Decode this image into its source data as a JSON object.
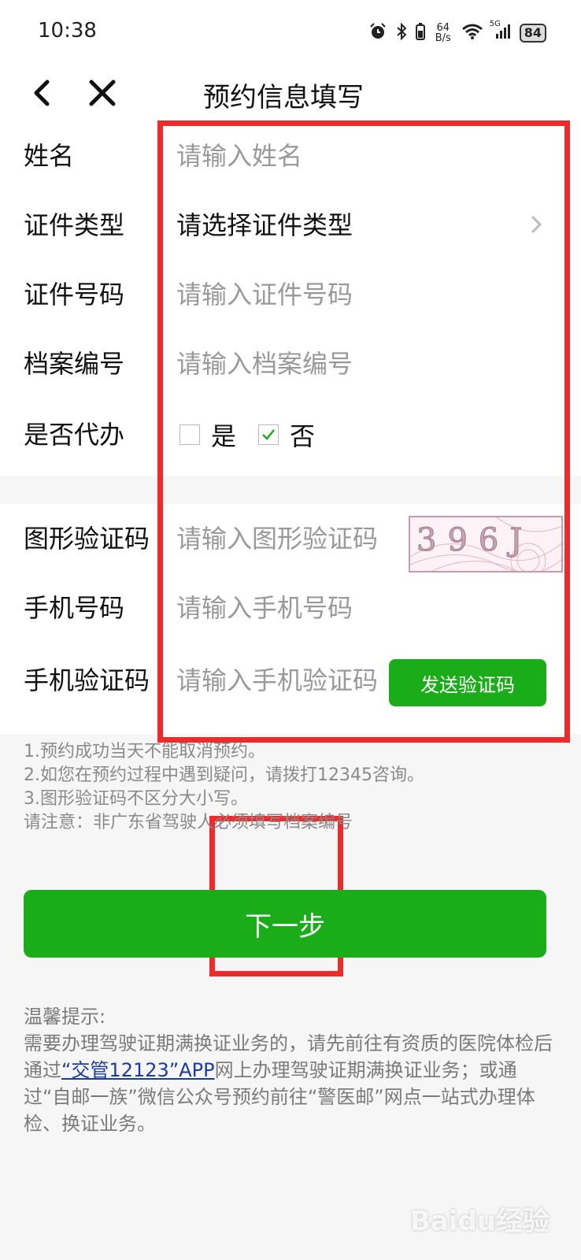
{
  "status_bar": {
    "time": "10:38",
    "net_speed_value": "64",
    "net_speed_unit": "B/s",
    "network": "5G",
    "battery": "84",
    "icons": [
      "alarm-icon",
      "bluetooth-icon",
      "wifi-icon",
      "signal-icon",
      "battery-icon"
    ]
  },
  "nav": {
    "title": "预约信息填写",
    "icons": [
      "back-icon",
      "close-icon"
    ]
  },
  "form": {
    "name_label": "姓名",
    "name_placeholder": "请输入姓名",
    "id_type_label": "证件类型",
    "id_type_value": "请选择证件类型",
    "id_number_label": "证件号码",
    "id_number_placeholder": "请输入证件号码",
    "file_number_label": "档案编号",
    "file_number_placeholder": "请输入档案编号",
    "proxy_label": "是否代办",
    "proxy_yes": "是",
    "proxy_no": "否",
    "proxy_selected": "否",
    "captcha_label": "图形验证码",
    "captcha_placeholder": "请输入图形验证码",
    "captcha_image_text": "396J",
    "phone_label": "手机号码",
    "phone_placeholder": "请输入手机号码",
    "sms_label": "手机验证码",
    "sms_placeholder": "请输入手机验证码",
    "send_code_label": "发送验证码"
  },
  "notes": [
    "1.预约成功当天不能取消预约。",
    "2.如您在预约过程中遇到疑问，请拨打12345咨询。",
    "3.图形验证码不区分大小写。",
    "请注意：非广东省驾驶人必须填写档案编号"
  ],
  "next_button": "下一步",
  "tips": {
    "heading": "温馨提示:",
    "text_before": "需要办理驾驶证期满换证业务的，请先前往有资质的医院体检后通过",
    "link": "“交管12123”APP",
    "text_after": "网上办理驾驶证期满换证业务；或通过“自邮一族”微信公众号预约前往“警医邮”网点一站式办理体检、换证业务。"
  },
  "watermark": "Baidu经验",
  "colors": {
    "primary_green": "#1aad19",
    "highlight_red": "#ee2a2a",
    "link_blue": "#1a3aa8"
  }
}
